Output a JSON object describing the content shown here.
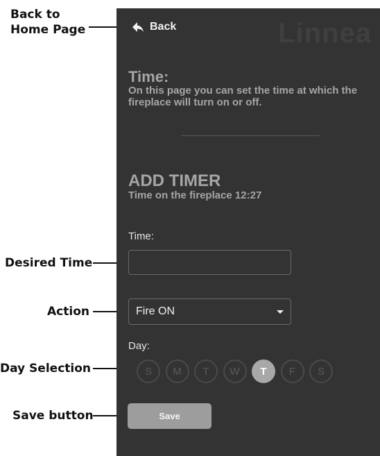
{
  "annotations": {
    "back": [
      "Back to",
      "Home Page"
    ],
    "desired_time": "Desired Time",
    "action": "Action",
    "day_selection": "Day Selection",
    "save_button": "Save button"
  },
  "header": {
    "back_label": "Back",
    "brand": "Linnea"
  },
  "intro": {
    "title": "Time:",
    "description": "On this page you can set the time at which the fireplace will turn on or off."
  },
  "timer": {
    "title": "ADD TIMER",
    "subtitle": "Time on the fireplace 12:27",
    "time_label": "Time:",
    "time_value": "",
    "action_selected": "Fire ON",
    "day_label": "Day:",
    "days": [
      {
        "letter": "S",
        "selected": false
      },
      {
        "letter": "M",
        "selected": false
      },
      {
        "letter": "T",
        "selected": false
      },
      {
        "letter": "W",
        "selected": false
      },
      {
        "letter": "T",
        "selected": true
      },
      {
        "letter": "F",
        "selected": false
      },
      {
        "letter": "S",
        "selected": false
      }
    ],
    "save_label": "Save"
  },
  "colors": {
    "panel_bg": "#333333",
    "accent": "#9d9d9d"
  }
}
